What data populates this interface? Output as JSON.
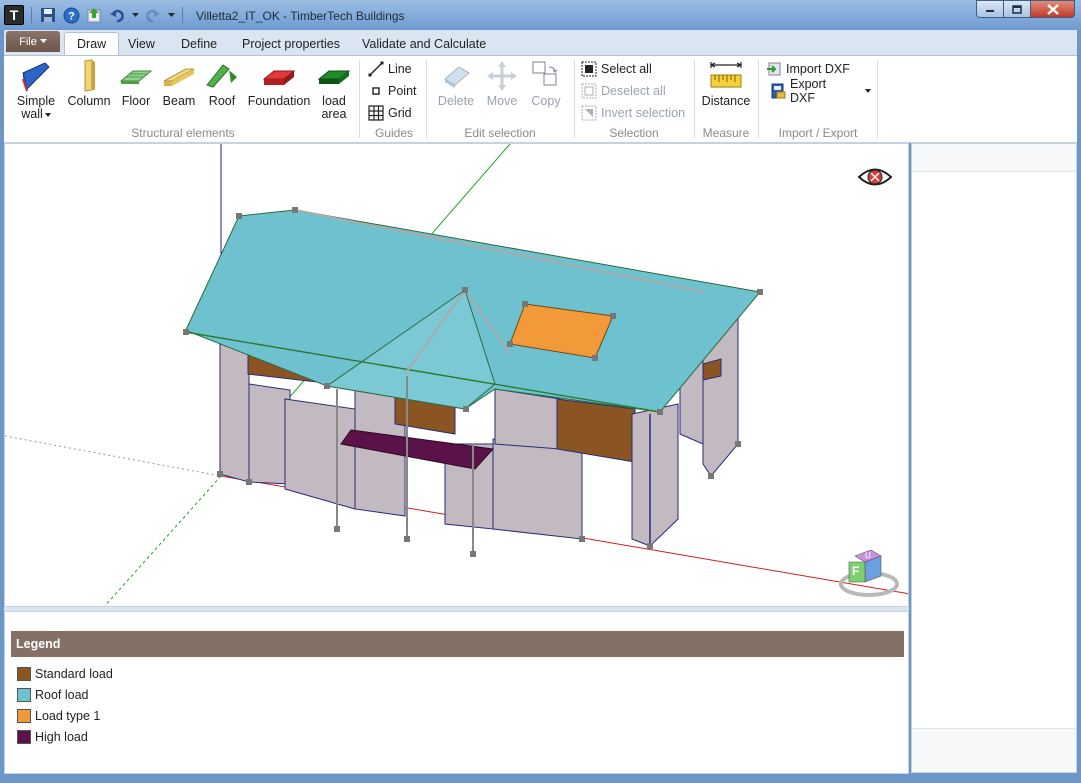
{
  "window": {
    "title": "Villetta2_IT_OK - TimberTech Buildings",
    "app_icon_letter": "T"
  },
  "quick_access": [
    {
      "icon": "save-icon"
    },
    {
      "icon": "help-icon"
    },
    {
      "icon": "upload-icon"
    },
    {
      "icon": "undo-icon"
    },
    {
      "icon": "redo-icon"
    }
  ],
  "ribbon": {
    "file_label": "File",
    "tabs": [
      {
        "label": "Draw",
        "active": true
      },
      {
        "label": "View"
      },
      {
        "label": "Define"
      },
      {
        "label": "Project properties"
      },
      {
        "label": "Validate and Calculate"
      }
    ],
    "structural": {
      "group_label": "Structural elements",
      "simple_wall": "Simple\nwall",
      "simple_wall_line1": "Simple",
      "simple_wall_line2": "wall",
      "column": "Column",
      "floor": "Floor",
      "beam": "Beam",
      "roof": "Roof",
      "foundation": "Foundation",
      "load_area_line1": "load",
      "load_area_line2": "area"
    },
    "guides": {
      "group_label": "Guides",
      "line": "Line",
      "point": "Point",
      "grid": "Grid"
    },
    "edit": {
      "group_label": "Edit selection",
      "delete": "Delete",
      "move": "Move",
      "copy": "Copy"
    },
    "selection": {
      "group_label": "Selection",
      "select_all": "Select all",
      "deselect_all": "Deselect all",
      "invert": "Invert selection"
    },
    "measure": {
      "group_label": "Measure",
      "distance": "Distance"
    },
    "import_export": {
      "group_label": "Import / Export",
      "import_dxf": "Import DXF",
      "export_dxf": "Export DXF"
    }
  },
  "viewcube": {
    "front_face": "F",
    "top_face": "U"
  },
  "legend": {
    "title": "Legend",
    "items": [
      {
        "label": "Standard load",
        "color": "#8b5523"
      },
      {
        "label": "Roof load",
        "color": "#6ec2d0"
      },
      {
        "label": "Load type 1",
        "color": "#f29a3a"
      },
      {
        "label": "High load",
        "color": "#5a1248"
      }
    ]
  },
  "colors": {
    "roof": "#6ec2d0",
    "wall": "#c2b9c1",
    "standard_load": "#8b5523",
    "load_type_1": "#f29a3a",
    "high_load": "#5a1248",
    "legend_header": "#857066"
  }
}
